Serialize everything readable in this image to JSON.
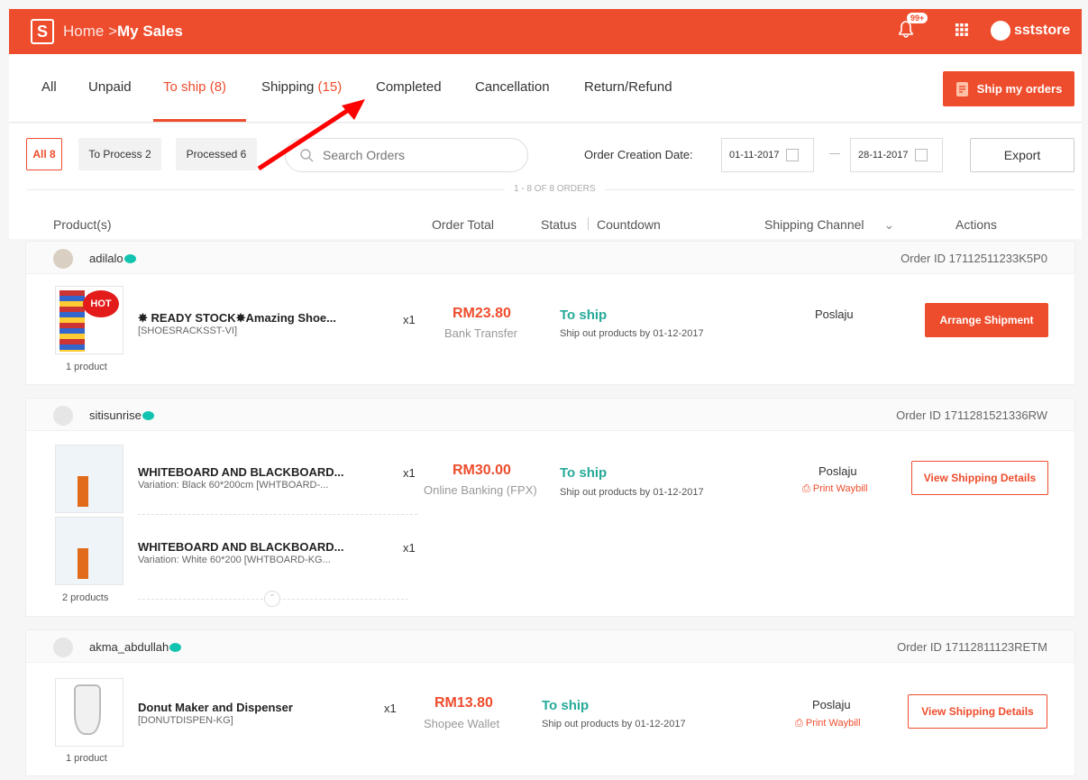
{
  "topbar": {
    "logo": "S",
    "home": "Home",
    "separator": " >",
    "current": "My Sales",
    "badge": "99+",
    "username": "sststore"
  },
  "tabs": [
    {
      "label": "All",
      "count": ""
    },
    {
      "label": "Unpaid",
      "count": ""
    },
    {
      "label": "To ship",
      "count": " (8)"
    },
    {
      "label": "Shipping",
      "count": " (15)"
    },
    {
      "label": "Completed",
      "count": ""
    },
    {
      "label": "Cancellation",
      "count": ""
    },
    {
      "label": "Return/Refund",
      "count": ""
    }
  ],
  "ship_button": "Ship my orders",
  "filters": {
    "all": "All 8",
    "to_process": "To Process 2",
    "processed": "Processed 6",
    "search_placeholder": "Search Orders",
    "date_label": "Order Creation Date:",
    "date_from": "01-11-2017",
    "date_to": "28-11-2017",
    "export": "Export",
    "order_count": "1 - 8 OF 8 ORDERS"
  },
  "columns": {
    "product": "Product(s)",
    "total": "Order Total",
    "status": "Status",
    "countdown": "Countdown",
    "channel": "Shipping Channel",
    "actions": "Actions"
  },
  "orders": [
    {
      "buyer": "adilalo",
      "order_id": "Order ID 17112511233K5P0",
      "items": [
        {
          "name": "✸ READY STOCK✸Amazing Shoe...",
          "sku": "[SHOESRACKSST-VI]",
          "qty": "x1",
          "thumb_text": "HOT"
        }
      ],
      "product_count": "1 product",
      "total": "RM23.80",
      "payment": "Bank Transfer",
      "status": "To ship",
      "ship_by": "Ship out products by 01-12-2017",
      "channel": "Poslaju",
      "waybill": "",
      "action": "Arrange Shipment"
    },
    {
      "buyer": "sitisunrise",
      "order_id": "Order ID 1711281521336RW",
      "items": [
        {
          "name": "WHITEBOARD AND BLACKBOARD...",
          "sku": "Variation: Black 60*200cm [WHTBOARD-...",
          "qty": "x1"
        },
        {
          "name": "WHITEBOARD AND BLACKBOARD...",
          "sku": "Variation: White 60*200 [WHTBOARD-KG...",
          "qty": "x1"
        }
      ],
      "product_count": "2 products",
      "total": "RM30.00",
      "payment": "Online Banking (FPX)",
      "status": "To ship",
      "ship_by": "Ship out products by 01-12-2017",
      "channel": "Poslaju",
      "waybill": "Print Waybill",
      "action": "View Shipping Details"
    },
    {
      "buyer": "akma_abdullah",
      "order_id": "Order ID 17112811123RETM",
      "items": [
        {
          "name": "Donut Maker and Dispenser",
          "sku": "[DONUTDISPEN-KG]",
          "qty": "x1"
        }
      ],
      "product_count": "1 product",
      "total": "RM13.80",
      "payment": "Shopee Wallet",
      "status": "To ship",
      "ship_by": "Ship out products by 01-12-2017",
      "channel": "Poslaju",
      "waybill": "Print Waybill",
      "action": "View Shipping Details"
    }
  ],
  "colors": {
    "brand": "#ee4d2d",
    "status": "#26aa99",
    "arrow": "#ff0000"
  }
}
